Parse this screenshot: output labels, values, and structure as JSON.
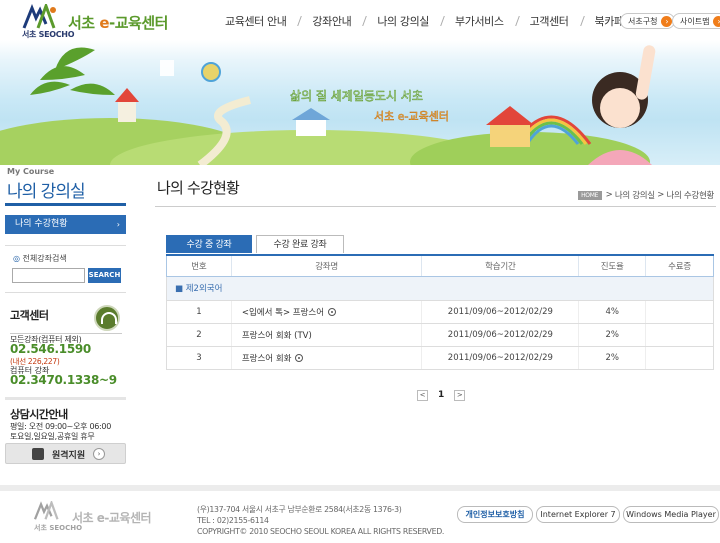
{
  "header": {
    "logo": {
      "sub": "서초 SEOCHO",
      "title_pre": "서초 ",
      "title_e": "e",
      "title_post": "-교육센터"
    },
    "gnb": [
      "교육센터 안내",
      "강좌안내",
      "나의 강의실",
      "부가서비스",
      "고객센터",
      "북카페"
    ],
    "util": [
      {
        "label": "서초구청",
        "icon": "arrow-right-icon"
      },
      {
        "label": "사이트맵",
        "icon": "arrow-right-icon"
      }
    ],
    "banner": {
      "slogan_line1": "삶의 질 세계일등도시 서초",
      "slogan_line2": "서초 e-교육센터"
    },
    "colors": {
      "brand_blue": "#2b6cb5",
      "brand_green": "#5b9a2c",
      "accent_orange": "#f07d1a"
    }
  },
  "sidebar": {
    "course_label": "My Course",
    "title": "나의 강의실",
    "menu": [
      {
        "label": "나의 수강현황",
        "icon": "chevron-right-icon"
      }
    ],
    "search": {
      "label": "전체강좌검색",
      "button": "SEARCH",
      "value": ""
    },
    "cs": {
      "title": "고객센터",
      "label1": "모든강좌(컴퓨터 제외)",
      "phone1": "02.546.1590",
      "sub1": "(내선 226,227)",
      "label2": "컴퓨터 강좌",
      "phone2": "02.3470.1338~9"
    },
    "hours": {
      "title": "상담시간안내",
      "line1": "평일: 오전 09:00~오후 06:00",
      "line2": "토요일,일요일,공휴일 휴무"
    },
    "remote": {
      "label": "원격지원",
      "icon": "monitor-icon"
    }
  },
  "main": {
    "title": "나의 수강현황",
    "breadcrumb": {
      "home": "HOME",
      "items": [
        "나의 강의실",
        "나의 수강현황"
      ],
      "separator": ">"
    },
    "tabs": [
      {
        "label": "수강 중 강좌",
        "active": true
      },
      {
        "label": "수강 완료 강좌",
        "active": false
      }
    ],
    "table": {
      "headers": [
        "번호",
        "강좌명",
        "학습기간",
        "진도율",
        "수료증"
      ],
      "group": "■ 제2외국어",
      "rows": [
        {
          "no": "1",
          "name": "<입에서 톡> 프랑스어",
          "period": "2011/09/06~2012/02/29",
          "progress": "4%",
          "cert": ""
        },
        {
          "no": "2",
          "name": "프랑스어 회화 (TV)",
          "period": "2011/09/06~2012/02/29",
          "progress": "2%",
          "cert": ""
        },
        {
          "no": "3",
          "name": "프랑스어 회화",
          "period": "2011/09/06~2012/02/29",
          "progress": "2%",
          "cert": ""
        }
      ]
    },
    "pager": {
      "prev": "<",
      "current": "1",
      "next": ">"
    }
  },
  "footer": {
    "logo_sub": "서초 SEOCHO",
    "logo_title": "서초 e-교육센터",
    "address": "(우)137-704 서울시 서초구 남부순환로 2584(서초2동 1376-3)",
    "tel": "TEL : 02)2155-6114",
    "copyright": "COPYRIGHT© 2010 SEOCHO SEOUL KOREA ALL RIGHTS RESERVED.",
    "buttons": [
      "개인정보보호방침",
      "Internet Explorer 7",
      "Windows Media Player"
    ]
  }
}
